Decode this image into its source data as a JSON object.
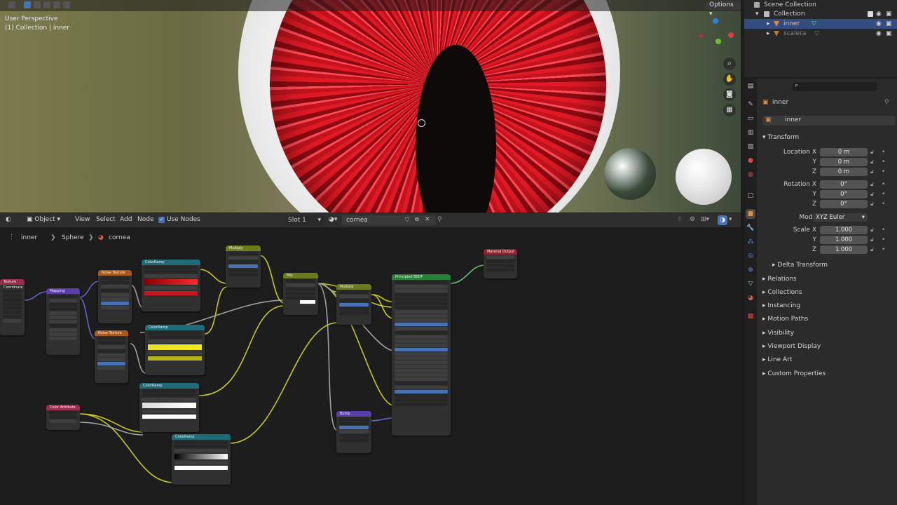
{
  "viewport": {
    "title_line1": "User Perspective",
    "title_line2": "(1) Collection | inner",
    "options_label": "Options"
  },
  "outliner": {
    "rows": [
      "Scene Collection",
      "Collection",
      "inner",
      "scalera"
    ]
  },
  "properties": {
    "search_placeholder": "",
    "object_name": "inner",
    "object_name_field": "inner",
    "transform_label": "Transform",
    "location_label": "Location X",
    "loc_x": "0 m",
    "loc_y": "0 m",
    "loc_z": "0 m",
    "rotation_label": "Rotation X",
    "rot_x": "0°",
    "rot_y": "0°",
    "rot_z": "0°",
    "mode_label": "Mode",
    "mode_value": "XYZ Euler",
    "scale_label": "Scale X",
    "scale_x": "1.000",
    "scale_y": "1.000",
    "scale_z": "1.000",
    "y_label": "Y",
    "z_label": "Z",
    "delta_transform": "Delta Transform",
    "panels": [
      "Relations",
      "Collections",
      "Instancing",
      "Motion Paths",
      "Visibility",
      "Viewport Display",
      "Line Art",
      "Custom Properties"
    ]
  },
  "node_header": {
    "editor_type": "Object",
    "menu": [
      "View",
      "Select",
      "Add",
      "Node"
    ],
    "use_nodes": "Use Nodes",
    "slot": "Slot 1",
    "material": "cornea"
  },
  "breadcrumb": [
    "inner",
    "Sphere",
    "cornea"
  ],
  "nodes": {
    "texcoord": "Texture Coordinate",
    "mapping": "Mapping",
    "noise1": "Noise Texture",
    "noise2": "Noise Texture",
    "ramp1": "ColorRamp",
    "ramp2": "ColorRamp",
    "ramp3": "ColorRamp",
    "ramp4": "ColorRamp",
    "multiply1": "Multiply",
    "mix": "Mix",
    "multiply2": "Multiply",
    "bsdf": "Principled BSDF",
    "output": "Material Output",
    "bump": "Bump",
    "color_attr": "Color Attribute"
  },
  "colors": {
    "accent_blue": "#4772b3",
    "wire_yellow": "#c7c729",
    "wire_gray": "#a1a1a1",
    "wire_purple": "#6363c7",
    "wire_green": "#63c763"
  }
}
